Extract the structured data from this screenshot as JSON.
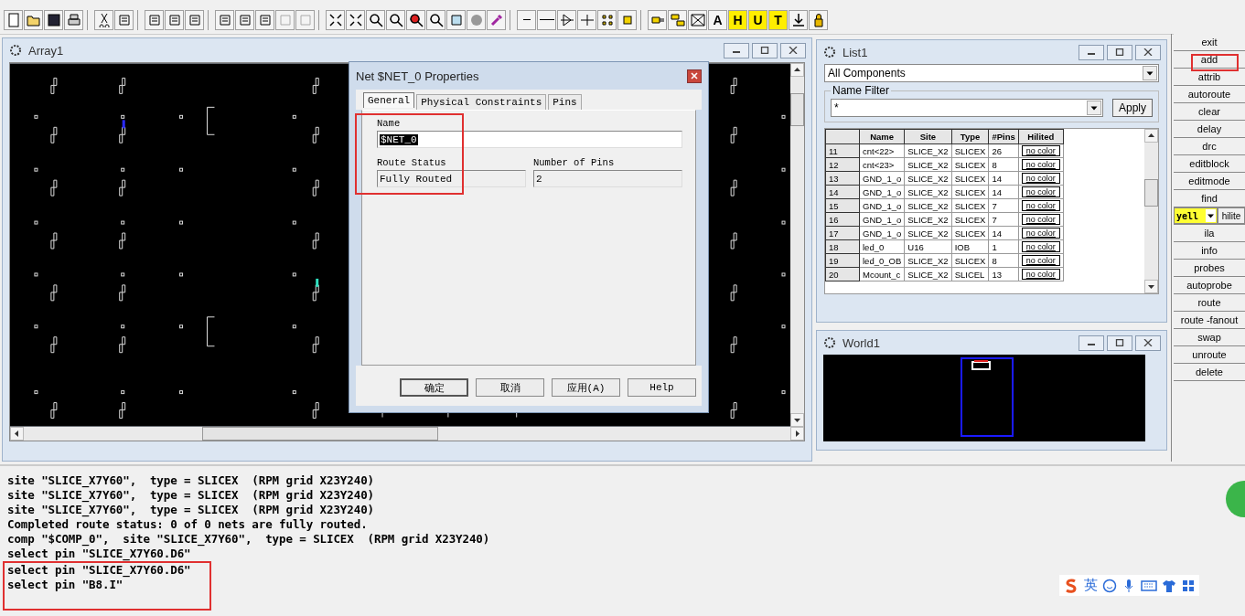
{
  "toolbar": {
    "letters": [
      {
        "label": "A",
        "kind": "plain"
      },
      {
        "label": "H",
        "kind": "yellow"
      },
      {
        "label": "U",
        "kind": "yellow"
      },
      {
        "label": "T",
        "kind": "yellow"
      }
    ]
  },
  "array_window": {
    "title": "Array1"
  },
  "dialog": {
    "title": "Net $NET_0 Properties",
    "tabs": [
      {
        "label": "General",
        "selected": true
      },
      {
        "label": "Physical Constraints",
        "selected": false
      },
      {
        "label": "Pins",
        "selected": false
      }
    ],
    "name_label": "Name",
    "name_value": "$NET_0",
    "route_status_label": "Route Status",
    "route_status_value": "Fully Routed",
    "pins_label": "Number of Pins",
    "pins_value": "2",
    "buttons": [
      {
        "label": "确定",
        "kind": "default"
      },
      {
        "label": "取消",
        "kind": "normal"
      },
      {
        "label": "应用(A)",
        "kind": "normal"
      },
      {
        "label": "Help",
        "kind": "normal"
      }
    ]
  },
  "list_window": {
    "title": "List1",
    "category": "All Components",
    "filter_label": "Name Filter",
    "filter_value": "*",
    "apply_button": "Apply",
    "columns": [
      "Name",
      "Site",
      "Type",
      "#Pins",
      "Hilited"
    ],
    "rows": [
      {
        "index": "11",
        "name": "cnt<22>",
        "site": "SLICE_X2",
        "type": "SLICEX",
        "pins": "26",
        "hilited": "no color"
      },
      {
        "index": "12",
        "name": "cnt<23>",
        "site": "SLICE_X2",
        "type": "SLICEX",
        "pins": "8",
        "hilited": "no color"
      },
      {
        "index": "13",
        "name": "GND_1_o",
        "site": "SLICE_X2",
        "type": "SLICEX",
        "pins": "14",
        "hilited": "no color"
      },
      {
        "index": "14",
        "name": "GND_1_o",
        "site": "SLICE_X2",
        "type": "SLICEX",
        "pins": "14",
        "hilited": "no color"
      },
      {
        "index": "15",
        "name": "GND_1_o",
        "site": "SLICE_X2",
        "type": "SLICEX",
        "pins": "7",
        "hilited": "no color"
      },
      {
        "index": "16",
        "name": "GND_1_o",
        "site": "SLICE_X2",
        "type": "SLICEX",
        "pins": "7",
        "hilited": "no color"
      },
      {
        "index": "17",
        "name": "GND_1_o",
        "site": "SLICE_X2",
        "type": "SLICEX",
        "pins": "14",
        "hilited": "no color"
      },
      {
        "index": "18",
        "name": "led_0",
        "site": "U16",
        "type": "IOB",
        "pins": "1",
        "hilited": "no color"
      },
      {
        "index": "19",
        "name": "led_0_OB",
        "site": "SLICE_X2",
        "type": "SLICEX",
        "pins": "8",
        "hilited": "no color"
      },
      {
        "index": "20",
        "name": "Mcount_c",
        "site": "SLICE_X2",
        "type": "SLICEL",
        "pins": "13",
        "hilited": "no color"
      }
    ]
  },
  "world_window": {
    "title": "World1"
  },
  "command_buttons": [
    {
      "kind": "button",
      "label": "exit"
    },
    {
      "kind": "button",
      "label": "add"
    },
    {
      "kind": "button",
      "label": "attrib"
    },
    {
      "kind": "button",
      "label": "autoroute"
    },
    {
      "kind": "button",
      "label": "clear"
    },
    {
      "kind": "button",
      "label": "delay"
    },
    {
      "kind": "button",
      "label": "drc"
    },
    {
      "kind": "button",
      "label": "editblock"
    },
    {
      "kind": "button",
      "label": "editmode"
    },
    {
      "kind": "button",
      "label": "find"
    },
    {
      "kind": "color-select",
      "value": "yell",
      "label": "hilite"
    },
    {
      "kind": "button",
      "label": "ila"
    },
    {
      "kind": "button",
      "label": "info"
    },
    {
      "kind": "button",
      "label": "probes"
    },
    {
      "kind": "button",
      "label": "autoprobe"
    },
    {
      "kind": "button",
      "label": "route"
    },
    {
      "kind": "button",
      "label": "route -fanout"
    },
    {
      "kind": "button",
      "label": "swap"
    },
    {
      "kind": "button",
      "label": "unroute"
    },
    {
      "kind": "button",
      "label": "delete"
    }
  ],
  "console": {
    "lines": [
      "site \"SLICE_X7Y60\",  type = SLICEX  (RPM grid X23Y240)",
      "site \"SLICE_X7Y60\",  type = SLICEX  (RPM grid X23Y240)",
      "site \"SLICE_X7Y60\",  type = SLICEX  (RPM grid X23Y240)",
      "Completed route status: 0 of 0 nets are fully routed.",
      "comp \"$COMP_0\",  site \"SLICE_X7Y60\",  type = SLICEX  (RPM grid X23Y240)",
      "select pin \"SLICE_X7Y60.D6\"",
      "select pin \"SLICE_X7Y60.D6\"",
      "select pin \"B8.I\""
    ]
  },
  "ime_bar": {
    "language": "英"
  }
}
